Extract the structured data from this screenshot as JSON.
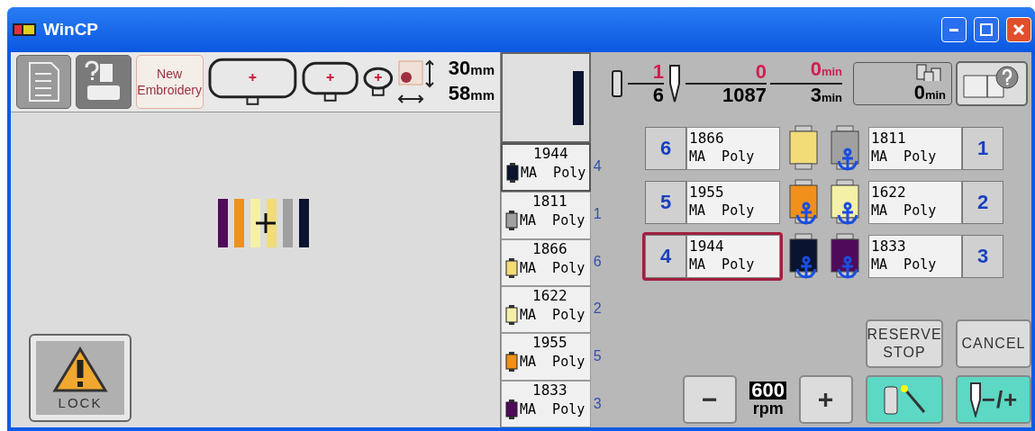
{
  "window": {
    "title": "WinCP"
  },
  "toolbar": {
    "new_button": [
      "New",
      "Embroidery"
    ],
    "height_value": "30",
    "height_unit": "mm",
    "width_value": "58",
    "width_unit": "mm"
  },
  "lock_button": {
    "label": "LOCK"
  },
  "thread_list": [
    {
      "code": "1944",
      "name": "MA  Poly",
      "color": "#0a1430",
      "needle": "4",
      "selected": true
    },
    {
      "code": "1811",
      "name": "MA  Poly",
      "color": "#a0a0a0",
      "needle": "1",
      "selected": false
    },
    {
      "code": "1866",
      "name": "MA  Poly",
      "color": "#f2dc78",
      "needle": "6",
      "selected": false
    },
    {
      "code": "1622",
      "name": "MA  Poly",
      "color": "#f5f0a8",
      "needle": "2",
      "selected": false
    },
    {
      "code": "1955",
      "name": "MA  Poly",
      "color": "#f0901a",
      "needle": "5",
      "selected": false
    },
    {
      "code": "1833",
      "name": "MA  Poly",
      "color": "#500a5a",
      "needle": "3",
      "selected": false
    }
  ],
  "status": {
    "color_current": "1",
    "color_total": "6",
    "stitch_current": "0",
    "stitch_total": "1087",
    "time_current": "0",
    "time_current_unit": "min",
    "time_total": "3",
    "time_total_unit": "min",
    "spool_time": "0",
    "spool_time_unit": "min"
  },
  "needle_rows": [
    {
      "left": {
        "number": "6",
        "code": "1866",
        "name": "MA  Poly",
        "color": "#f2dc78",
        "anchored": false,
        "selected": false
      },
      "right": {
        "number": "1",
        "code": "1811",
        "name": "MA  Poly",
        "color": "#a0a0a0",
        "anchored": true,
        "selected": false
      }
    },
    {
      "left": {
        "number": "5",
        "code": "1955",
        "name": "MA  Poly",
        "color": "#f0901a",
        "anchored": true,
        "selected": false
      },
      "right": {
        "number": "2",
        "code": "1622",
        "name": "MA  Poly",
        "color": "#f5f0a8",
        "anchored": true,
        "selected": false
      }
    },
    {
      "left": {
        "number": "4",
        "code": "1944",
        "name": "MA  Poly",
        "color": "#0a1430",
        "anchored": true,
        "selected": true
      },
      "right": {
        "number": "3",
        "code": "1833",
        "name": "MA  Poly",
        "color": "#500a5a",
        "anchored": true,
        "selected": false
      }
    }
  ],
  "controls": {
    "reserve_stop": [
      "RESERVE",
      "STOP"
    ],
    "cancel": "CANCEL",
    "minus": "−",
    "plus": "+",
    "speed": "600",
    "speed_unit": "rpm",
    "needle_adjust": "−/+"
  }
}
